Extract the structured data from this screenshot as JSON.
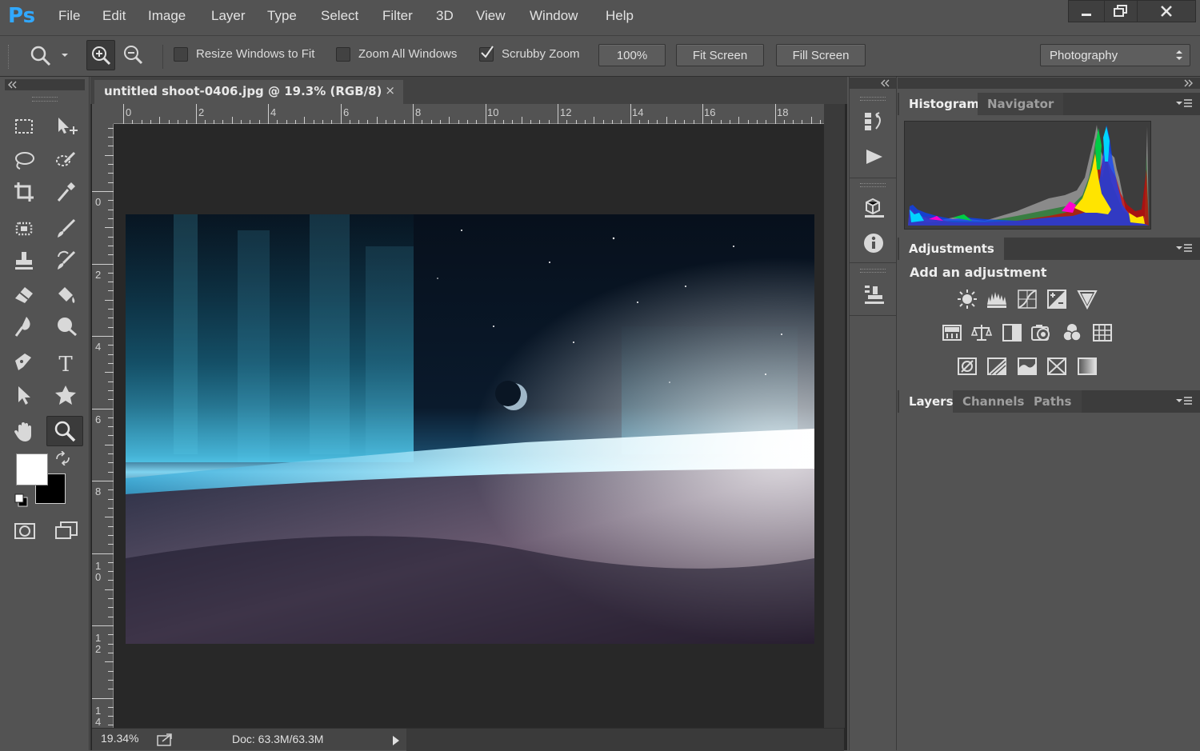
{
  "app": {
    "logo": "Ps"
  },
  "menu": [
    "File",
    "Edit",
    "Image",
    "Layer",
    "Type",
    "Select",
    "Filter",
    "3D",
    "View",
    "Window",
    "Help"
  ],
  "window_controls": {
    "minimize": "minimize",
    "restore": "restore",
    "close": "close"
  },
  "options_bar": {
    "resize_windows": {
      "label": "Resize Windows to Fit",
      "checked": false
    },
    "zoom_all": {
      "label": "Zoom All Windows",
      "checked": false
    },
    "scrubby_zoom": {
      "label": "Scrubby Zoom",
      "checked": true
    },
    "btn_100": "100%",
    "btn_fit": "Fit Screen",
    "btn_fill": "Fill Screen",
    "workspace": "Photography"
  },
  "document": {
    "tab_title": "untitled shoot-0406.jpg @ 19.3% (RGB/8)",
    "tab_close": "×",
    "h_ruler": [
      "0",
      "2",
      "4",
      "6",
      "8",
      "10",
      "12",
      "14",
      "16",
      "18"
    ],
    "v_ruler": [
      [
        "0"
      ],
      [
        "2"
      ],
      [
        "4"
      ],
      [
        "6"
      ],
      [
        "8"
      ],
      [
        "1",
        "0"
      ],
      [
        "1",
        "2"
      ],
      [
        "1",
        "4"
      ]
    ],
    "zoom": "19.34%",
    "doc_size": "Doc: 63.3M/63.3M"
  },
  "panels": {
    "top_tabs": [
      "Histogram",
      "Navigator"
    ],
    "adjustments_tab": "Adjustments",
    "adjustments_title": "Add an adjustment",
    "adjustment_icons": [
      [
        "brightness-contrast-icon",
        "levels-icon",
        "curves-icon",
        "exposure-icon",
        "vibrance-icon"
      ],
      [
        "hue-saturation-icon",
        "color-balance-icon",
        "black-white-icon",
        "photo-filter-icon",
        "channel-mixer-icon",
        "color-lookup-icon"
      ],
      [
        "invert-icon",
        "posterize-icon",
        "threshold-icon",
        "selective-color-icon",
        "gradient-map-icon"
      ]
    ],
    "bottom_tabs": [
      "Layers",
      "Channels",
      "Paths"
    ]
  },
  "colors": {
    "foreground": "#ffffff",
    "background": "#000000",
    "accent": "#31a8ff"
  }
}
